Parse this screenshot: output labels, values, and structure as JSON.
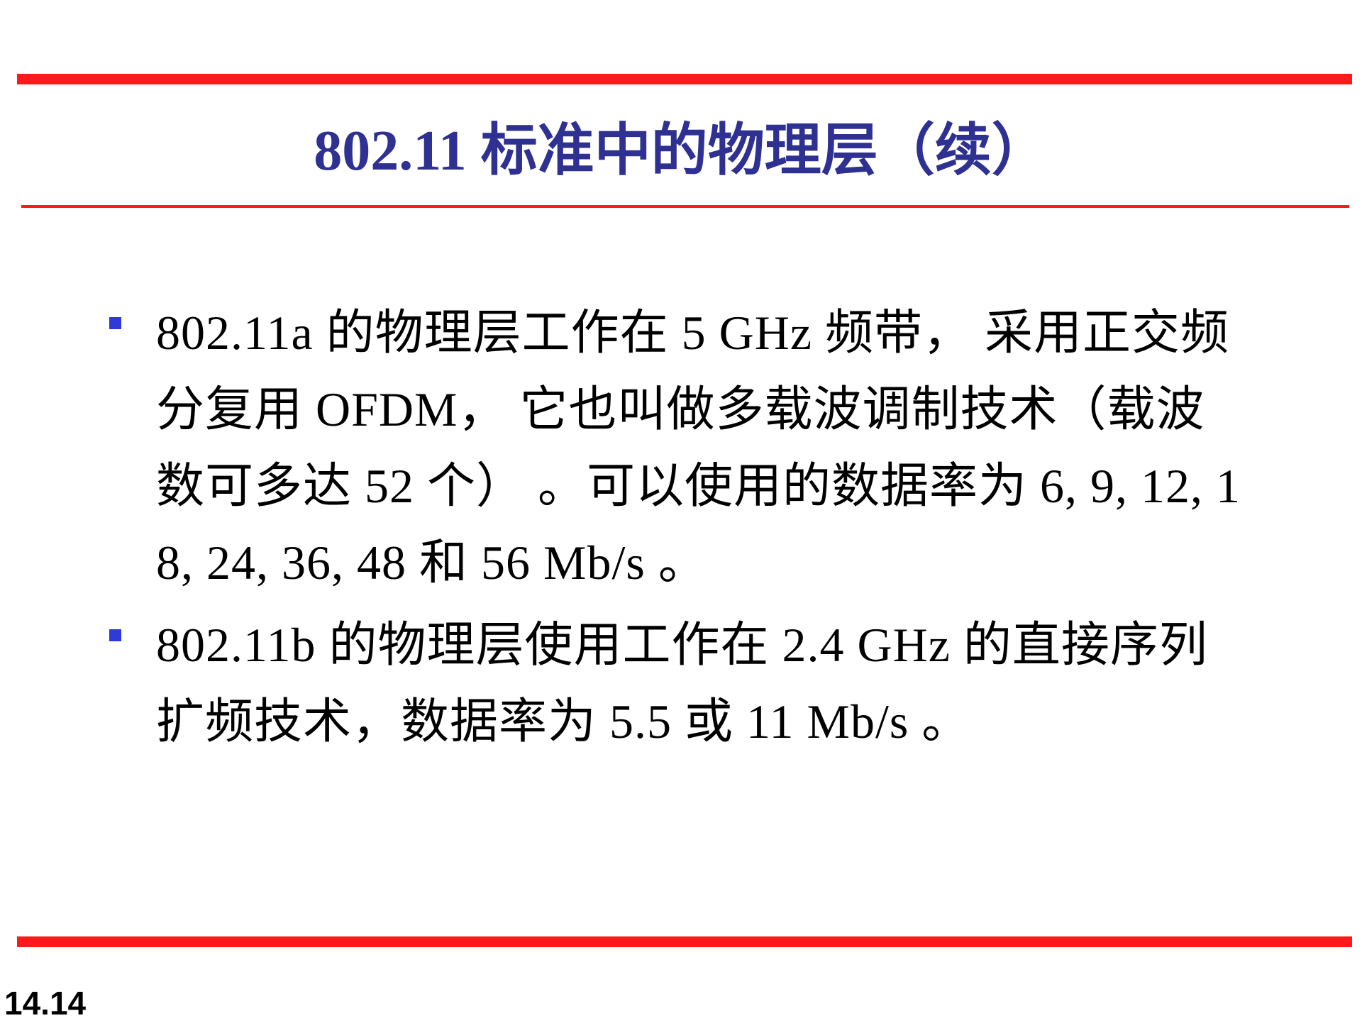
{
  "slide": {
    "title": "802.11  标准中的物理层（续）",
    "bullets": [
      {
        "text": "802.11a  的物理层工作在   5 GHz 频带，  采用正交频分复用   OFDM，  它也叫做多载波调制技术（载波数可多达   52  个）  。可以使用的数据率为   6, 9, 12, 18, 24, 36, 48  和   56 Mb/s 。"
      },
      {
        "text": "802.11b  的物理层使用工作在   2.4 GHz  的直接序列扩频技术，数据率为   5.5  或   11 Mb/s 。"
      }
    ],
    "slide_number": "14.14",
    "colors": {
      "rule": "#ff1a1a",
      "title": "#2e3192",
      "bullet_marker": "#2e3bd6",
      "body_text": "#000000"
    }
  }
}
